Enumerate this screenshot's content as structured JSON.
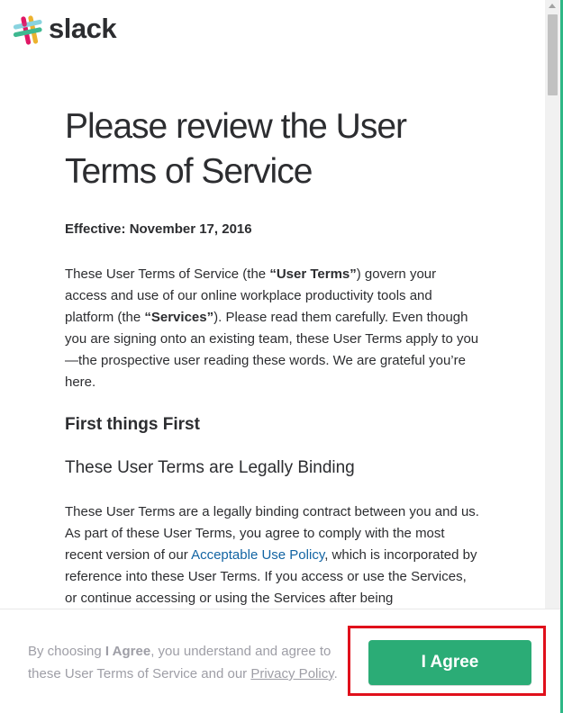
{
  "brand": {
    "name": "slack",
    "colors": {
      "accent_green": "#2bac76",
      "link_blue": "#1264a3",
      "highlight_red": "#e0101b"
    },
    "logo_icon": "slack-hash-icon"
  },
  "main": {
    "title": "Please review the User Terms of Service",
    "effective": "Effective: November 17, 2016",
    "intro": {
      "p1": "These User Terms of Service (the ",
      "b1": "“User Terms”",
      "p2": ") govern your access and use of our online workplace productivity tools and platform (the ",
      "b2": "“Services”",
      "p3": "). Please read them carefully. Even though you are signing onto an existing team, these User Terms apply to you —the prospective user reading these words. We are grateful you’re here."
    },
    "section_heading": "First things First",
    "subsection_heading": "These User Terms are Legally Binding",
    "binding": {
      "p1": "These User Terms are a legally binding contract between you and us. As part of these User Terms, you agree to comply with the most recent version of our ",
      "link": "Acceptable Use Policy",
      "p2": ", which is incorporated by reference into these User Terms. If you access or use the Services, or continue accessing or using the Services after being"
    }
  },
  "footer": {
    "t1": "By choosing ",
    "b1": "I Agree",
    "t2": ", you understand and agree to these User Terms of Service and our ",
    "link": "Privacy Policy",
    "t3": ".",
    "agree_label": "I Agree"
  }
}
